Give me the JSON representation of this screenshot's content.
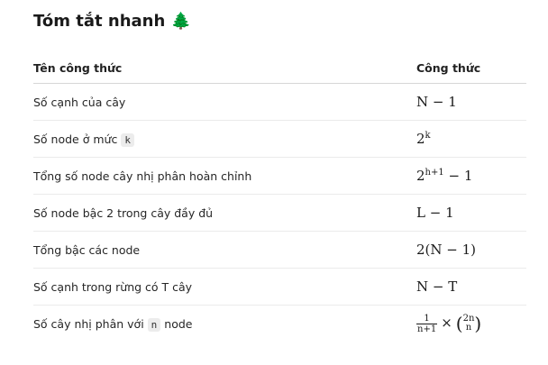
{
  "title": "Tóm tắt nhanh",
  "title_icon": "🌲",
  "table": {
    "headers": [
      "Tên công thức",
      "Công thức"
    ],
    "rows": [
      {
        "name": "Số cạnh của cây",
        "formula": "N − 1"
      },
      {
        "name_pre": "Số node ở mức",
        "name_code": "k",
        "formula_base": "2",
        "formula_sup": "k"
      },
      {
        "name": "Tổng số node cây nhị phân hoàn chỉnh",
        "formula_base": "2",
        "formula_sup": "h+1",
        "formula_tail": " − 1"
      },
      {
        "name": "Số node bậc 2 trong cây đầy đủ",
        "formula": "L − 1"
      },
      {
        "name": "Tổng bậc các node",
        "formula": "2(N − 1)"
      },
      {
        "name": "Số cạnh trong rừng có T cây",
        "formula": "N − T"
      },
      {
        "name_pre": "Số cây nhị phân với",
        "name_code": "n",
        "name_post": "node",
        "frac_num": "1",
        "frac_den": "n+1",
        "times": "×",
        "binom_top": "2n",
        "binom_bot": "n"
      }
    ]
  }
}
